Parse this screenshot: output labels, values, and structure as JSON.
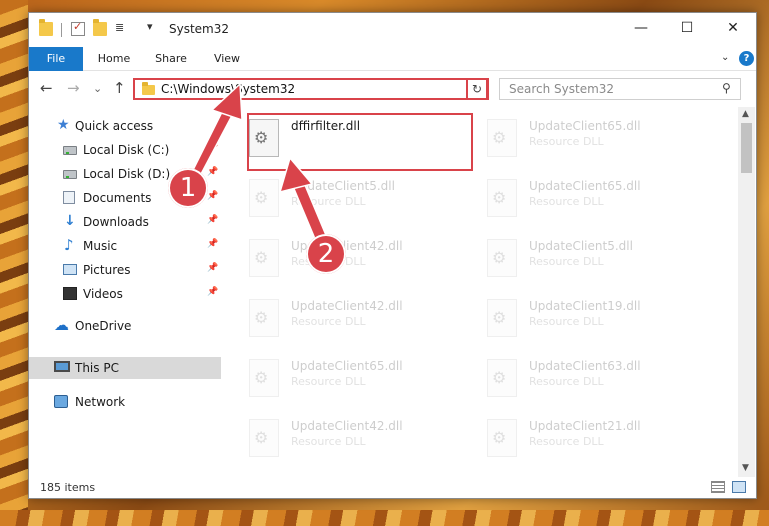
{
  "window": {
    "title": "System32",
    "title_menu": "≣",
    "title_menu_arrow": "▾",
    "minimize": "—",
    "maximize": "☐",
    "close": "✕"
  },
  "ribbon": {
    "tabs": [
      {
        "label": "File"
      },
      {
        "label": "Home"
      },
      {
        "label": "Share"
      },
      {
        "label": "View"
      }
    ],
    "expand": "⌄",
    "help": "?"
  },
  "nav": {
    "back": "←",
    "forward": "→",
    "recent": "⌄",
    "up": "↑",
    "address": "C:\\Windows\\System32",
    "address_dropdown": "⌄",
    "refresh": "↻",
    "search_placeholder": "Search System32",
    "search_icon": "⚲"
  },
  "sidebar": {
    "items": [
      {
        "label": "Quick access",
        "icon": "star-icon"
      },
      {
        "label": "Local Disk (C:)",
        "icon": "disk-icon",
        "pinned": true
      },
      {
        "label": "Local Disk (D:)",
        "icon": "disk-icon",
        "pinned": true
      },
      {
        "label": "Documents",
        "icon": "documents-icon",
        "pinned": true
      },
      {
        "label": "Downloads",
        "icon": "downloads-icon",
        "pinned": true
      },
      {
        "label": "Music",
        "icon": "music-icon",
        "pinned": true
      },
      {
        "label": "Pictures",
        "icon": "pictures-icon",
        "pinned": true
      },
      {
        "label": "Videos",
        "icon": "videos-icon",
        "pinned": true
      },
      {
        "label": "OneDrive",
        "icon": "cloud-icon"
      },
      {
        "label": "This PC",
        "icon": "computer-icon",
        "selected": true
      },
      {
        "label": "Network",
        "icon": "network-icon"
      }
    ],
    "pin_glyph": "📌"
  },
  "files": [
    {
      "name": "dffirfilter.dll",
      "type": "",
      "faded": false
    },
    {
      "name": "UpdateClient65.dll",
      "type": "Resource DLL",
      "faded": true
    },
    {
      "name": "UpdateClient5.dll",
      "type": "Resource DLL",
      "faded": true
    },
    {
      "name": "UpdateClient65.dll",
      "type": "Resource DLL",
      "faded": true
    },
    {
      "name": "UpdateClient42.dll",
      "type": "Resource DLL",
      "faded": true
    },
    {
      "name": "UpdateClient5.dll",
      "type": "Resource DLL",
      "faded": true
    },
    {
      "name": "UpdateClient42.dll",
      "type": "Resource DLL",
      "faded": true
    },
    {
      "name": "UpdateClient19.dll",
      "type": "Resource DLL",
      "faded": true
    },
    {
      "name": "UpdateClient65.dll",
      "type": "Resource DLL",
      "faded": true
    },
    {
      "name": "UpdateClient63.dll",
      "type": "Resource DLL",
      "faded": true
    },
    {
      "name": "UpdateClient42.dll",
      "type": "Resource DLL",
      "faded": true
    },
    {
      "name": "UpdateClient21.dll",
      "type": "Resource DLL",
      "faded": true
    },
    {
      "name": "",
      "type": "",
      "faded": true
    },
    {
      "name": "",
      "type": "",
      "faded": true
    }
  ],
  "scrollbar": {
    "up": "▲",
    "down": "▼"
  },
  "status": {
    "item_count": "185 items"
  },
  "annotations": [
    {
      "label": "1"
    },
    {
      "label": "2"
    }
  ],
  "colors": {
    "accent": "#1979ca",
    "highlight": "#d9434a",
    "selected_nav": "#d9d9d9"
  }
}
